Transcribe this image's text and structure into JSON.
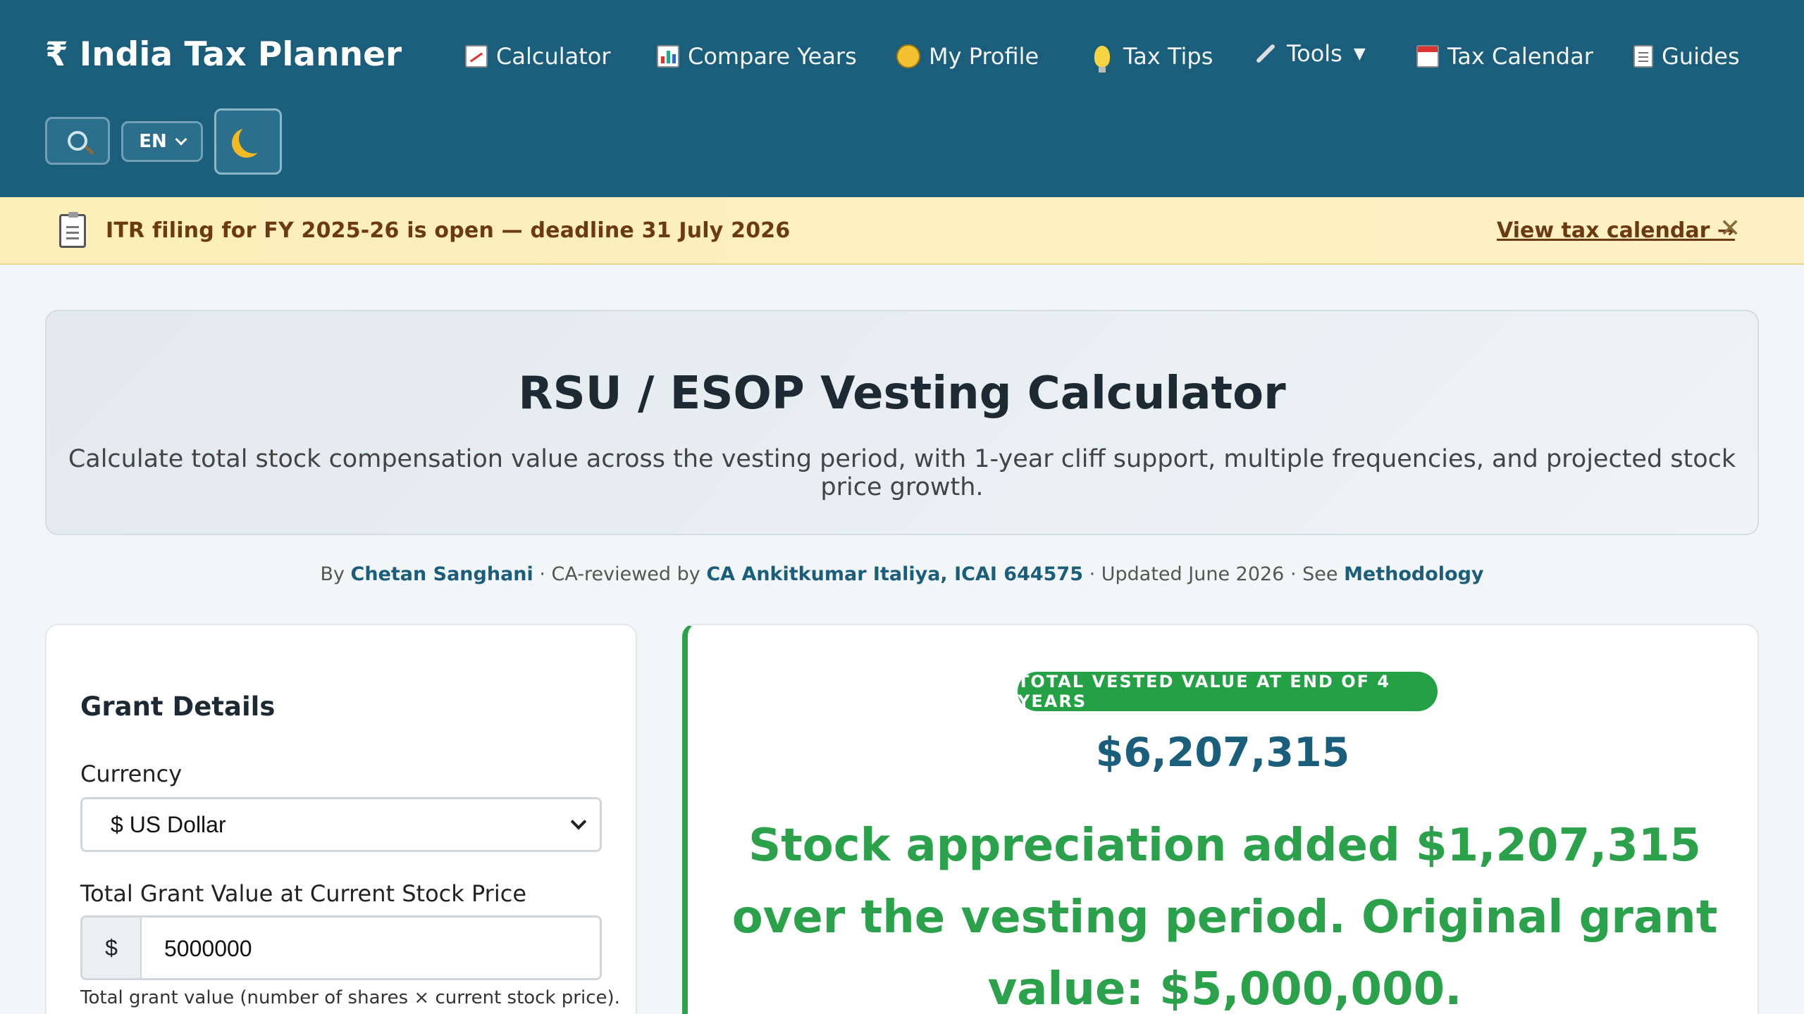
{
  "brand": {
    "symbol": "₹",
    "name": "India Tax Planner"
  },
  "nav": {
    "items": [
      {
        "label": "Calculator",
        "icon": "chart-increasing-icon"
      },
      {
        "label": "Compare Years",
        "icon": "bar-chart-icon"
      },
      {
        "label": "My Profile",
        "icon": "face-icon"
      },
      {
        "label": "Tax Tips",
        "icon": "light-bulb-icon"
      },
      {
        "label": "Tools",
        "icon": "wrench-icon",
        "caret": "▼"
      },
      {
        "label": "Tax Calendar",
        "icon": "calendar-icon"
      },
      {
        "label": "Guides",
        "icon": "memo-icon"
      }
    ]
  },
  "controls": {
    "language": "EN",
    "search_icon": "search-icon",
    "theme_icon": "moon-icon"
  },
  "banner": {
    "text": "ITR filing for FY 2025-26 is open — deadline 31 July 2026",
    "link": "View tax calendar →",
    "close": "✕"
  },
  "hero": {
    "title": "RSU / ESOP Vesting Calculator",
    "subtitle": "Calculate total stock compensation value across the vesting period, with 1-year cliff support, multiple frequencies, and projected stock price growth."
  },
  "byline": {
    "by": "By ",
    "author": "Chetan Sanghani",
    "reviewed": " · CA-reviewed by ",
    "reviewer": "CA Ankitkumar Italiya, ICAI 644575",
    "updated": " · Updated June 2026 · See ",
    "methodology": "Methodology"
  },
  "form": {
    "section_title": "Grant Details",
    "currency_label": "Currency",
    "currency_value": "$ US Dollar",
    "grant_label": "Total Grant Value at Current Stock Price",
    "grant_prefix": "$",
    "grant_value": "5000000",
    "grant_help": "Total grant value (number of shares × current stock price)."
  },
  "results": {
    "pill": "TOTAL VESTED VALUE AT END OF 4 YEARS",
    "total_value": "$6,207,315",
    "appreciation": "Stock appreciation added $1,207,315 over the vesting period. Original grant value: $5,000,000."
  },
  "colors": {
    "header": "#1b5e7b",
    "banner": "#fdefb9",
    "accent_green": "#2aa14a",
    "accent_blue": "#1b5e7b"
  }
}
